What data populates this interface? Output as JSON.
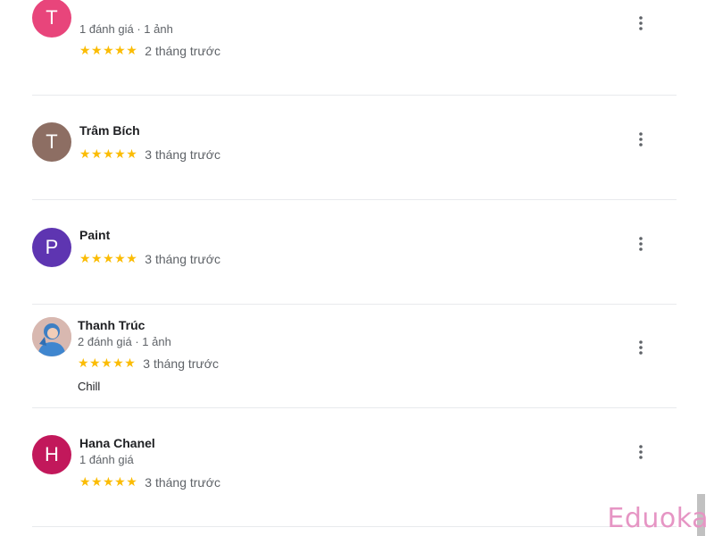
{
  "reviews": [
    {
      "initial": "T",
      "avatar_color": "#e8457b",
      "name": "",
      "meta": "1 đánh giá · 1 ảnh",
      "stars": "★★★★★",
      "rating": 5,
      "when": "2 tháng trước",
      "text": ""
    },
    {
      "initial": "T",
      "avatar_color": "#8d6e63",
      "name": "Trâm Bích",
      "meta": "",
      "stars": "★★★★★",
      "rating": 5,
      "when": "3 tháng trước",
      "text": ""
    },
    {
      "initial": "P",
      "avatar_color": "#5e35b1",
      "name": "Paint",
      "meta": "",
      "stars": "★★★★★",
      "rating": 5,
      "when": "3 tháng trước",
      "text": ""
    },
    {
      "initial": "",
      "avatar_color": "#c7a6a0",
      "name": "Thanh Trúc",
      "meta": "2 đánh giá · 1 ảnh",
      "stars": "★★★★★",
      "rating": 5,
      "when": "3 tháng trước",
      "text": "Chill"
    },
    {
      "initial": "H",
      "avatar_color": "#c2185b",
      "name": "Hana Chanel",
      "meta": "1 đánh giá",
      "stars": "★★★★★",
      "rating": 5,
      "when": "3 tháng trước",
      "text": ""
    }
  ],
  "more_icon": "more-vert-icon",
  "watermark": "Eduoka",
  "colors": {
    "star": "#fbbc04",
    "divider": "#e8eaed",
    "secondary_text": "#5f6368"
  }
}
